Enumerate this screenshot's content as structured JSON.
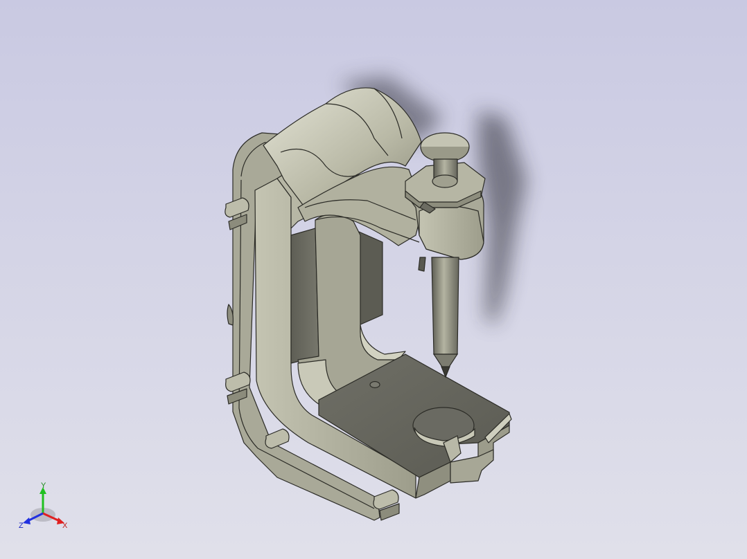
{
  "triad": {
    "x_label": "X",
    "y_label": "Y",
    "z_label": "Z",
    "x_color": "#e02020",
    "y_color": "#20c020",
    "z_color": "#2030e0"
  },
  "viewport": {
    "background_top": "#c9c9e2",
    "background_bottom": "#e0e0ea",
    "model_color": "#9a9a88"
  }
}
